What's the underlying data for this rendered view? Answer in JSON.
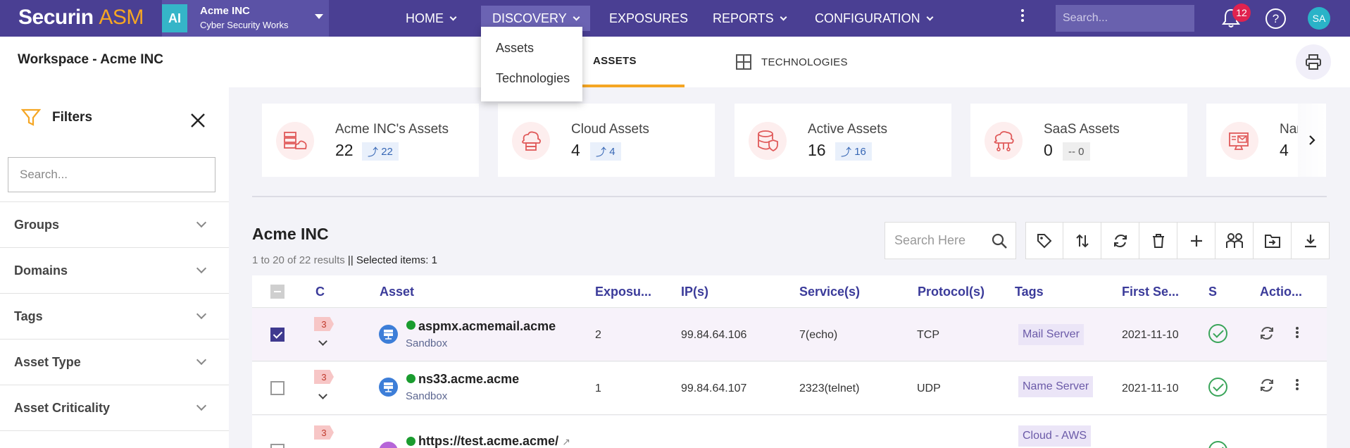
{
  "app": {
    "logo_primary": "Securin",
    "logo_accent": "ASM",
    "workspace_avatar": "AI",
    "workspace_name": "Acme INC",
    "workspace_org": "Cyber Security Works",
    "nav": [
      {
        "label": "HOME"
      },
      {
        "label": "DISCOVERY"
      },
      {
        "label": "EXPOSURES"
      },
      {
        "label": "REPORTS"
      },
      {
        "label": "CONFIGURATION"
      }
    ],
    "search_placeholder": "Search...",
    "notification_count": "12",
    "help_label": "?",
    "user_initials": "SA"
  },
  "discovery_menu": [
    "Assets",
    "Technologies"
  ],
  "workspace": {
    "title": "Workspace - Acme INC",
    "tabs": [
      {
        "label": "ASSETS"
      },
      {
        "label": "TECHNOLOGIES"
      }
    ]
  },
  "filters": {
    "title": "Filters",
    "search_placeholder": "Search...",
    "facets": [
      "Groups",
      "Domains",
      "Tags",
      "Asset Type",
      "Asset Criticality"
    ]
  },
  "cards": [
    {
      "label": "Acme INC's Assets",
      "value": "22",
      "trend": "22",
      "icon": "servers-cloud-icon"
    },
    {
      "label": "Cloud Assets",
      "value": "4",
      "trend": "4",
      "icon": "cloud-server-icon"
    },
    {
      "label": "Active Assets",
      "value": "16",
      "trend": "16",
      "icon": "database-shield-icon"
    },
    {
      "label": "SaaS Assets",
      "value": "0",
      "trend": "-- 0",
      "icon": "cloud-network-icon"
    },
    {
      "label": "Nar",
      "value": "4",
      "icon": "mail-monitor-icon"
    }
  ],
  "table": {
    "title": "Acme INC",
    "results_text": "1 to 20 of 22 results",
    "selected_text": "|| Selected items: 1",
    "search_placeholder": "Search Here",
    "columns": [
      "C",
      "Asset",
      "Exposu...",
      "IP(s)",
      "Service(s)",
      "Protocol(s)",
      "Tags",
      "First Se...",
      "S",
      "Actio..."
    ],
    "rows": [
      {
        "criticality": "3",
        "asset": "aspmx.acmemail.acme",
        "env": "Sandbox",
        "exposures": "2",
        "ip": "99.84.64.106",
        "service": "7(echo)",
        "protocol": "TCP",
        "tag": "Mail Server",
        "first_seen": "2021-11-10",
        "selected": true
      },
      {
        "criticality": "3",
        "asset": "ns33.acme.acme",
        "env": "Sandbox",
        "exposures": "1",
        "ip": "99.84.64.107",
        "service": "2323(telnet)",
        "protocol": "UDP",
        "tag": "Name Server",
        "first_seen": "2021-11-10",
        "selected": false
      },
      {
        "criticality": "3",
        "asset": "https://test.acme.acme/",
        "tag": "Cloud - AWS",
        "selected": false
      }
    ]
  }
}
